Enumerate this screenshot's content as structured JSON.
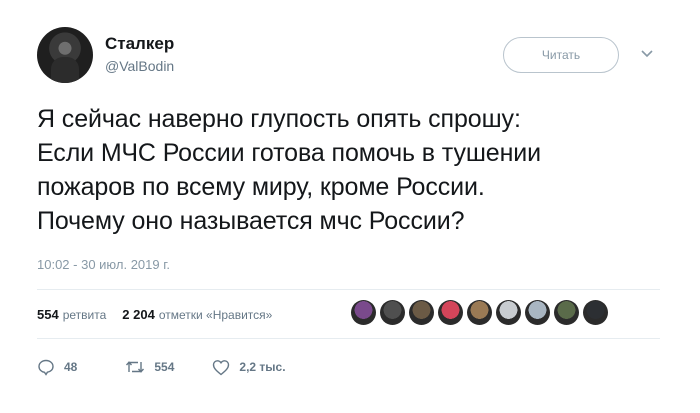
{
  "author": {
    "name": "Сталкер",
    "handle": "@ValBodin"
  },
  "follow_button_label": "Читать",
  "tweet": {
    "lines": [
      "Я сейчас наверно глупость опять спрошу:",
      "Если МЧС России готова помочь в тушении",
      "пожаров по всему миру, кроме России.",
      "Почему оно называется мчс России?"
    ],
    "timestamp": "10:02 - 30 июл. 2019 г."
  },
  "stats": {
    "retweets_count": "554",
    "retweets_label": "ретвита",
    "likes_count": "2 204",
    "likes_label": "отметки «Нравится»"
  },
  "likers": [
    {
      "icon": "liker-avatar-1",
      "color": "#7a4a8c"
    },
    {
      "icon": "liker-avatar-2",
      "color": "#4f4f4f"
    },
    {
      "icon": "liker-avatar-3",
      "color": "#6b5a45"
    },
    {
      "icon": "liker-avatar-4",
      "color": "#d4455a"
    },
    {
      "icon": "liker-avatar-5",
      "color": "#9a7a55"
    },
    {
      "icon": "liker-avatar-6",
      "color": "#c8ccd0"
    },
    {
      "icon": "liker-avatar-7",
      "color": "#a9b6c2"
    },
    {
      "icon": "liker-avatar-8",
      "color": "#5a6b4a"
    },
    {
      "icon": "liker-avatar-9",
      "color": "#2c2f33"
    }
  ],
  "actions": {
    "replies": "48",
    "retweets": "554",
    "likes": "2,2 тыс."
  },
  "colors": {
    "text": "#14171a",
    "secondary": "#657786",
    "divider": "#e6ecf0"
  }
}
